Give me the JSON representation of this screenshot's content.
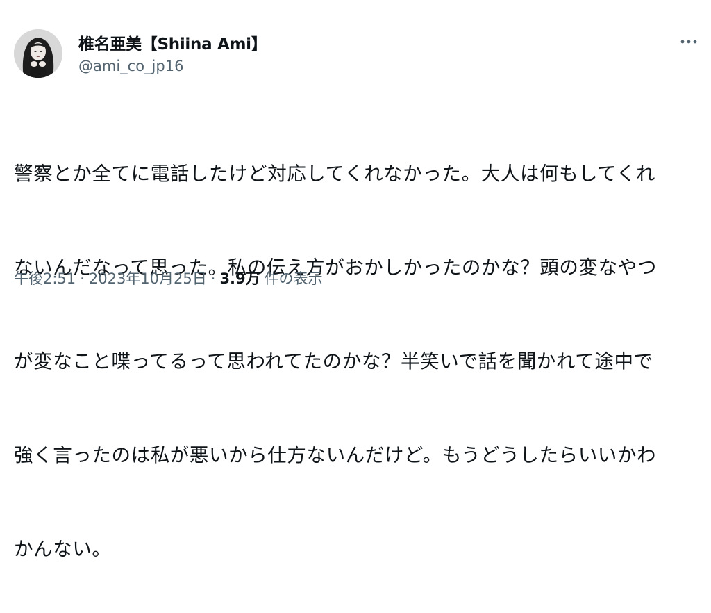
{
  "author": {
    "display_name": "椎名亜美【Shiina Ami】",
    "handle": "@ami_co_jp16",
    "avatar_icon": "profile-photo-avatar"
  },
  "more_icon": "more-options-icon",
  "tweet": {
    "lines": [
      "警察とか全てに電話したけど対応してくれなかった。大人は何もしてくれ",
      "ないんだなって思った。私の伝え方がおかしかったのかな？頭の変なやつ",
      "が変なこと喋ってるって思われてたのかな？半笑いで話を聞かれて途中で",
      "強く言ったのは私が悪いから仕方ないんだけど。もうどうしたらいいかわ",
      "かんない。"
    ]
  },
  "meta": {
    "time": "午後2:51",
    "separator": "·",
    "date": "2023年10月25日",
    "views_count": "3.9万",
    "views_label": "件の表示"
  },
  "colors": {
    "text": "#0f1419",
    "secondary": "#536471",
    "background": "#ffffff"
  }
}
